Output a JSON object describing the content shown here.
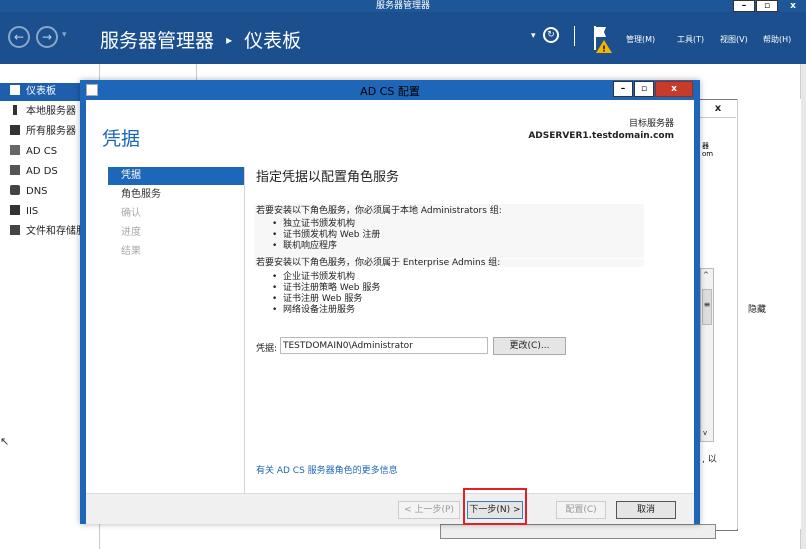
{
  "sm": {
    "title": "服务器管理器",
    "crumb": "服务器管理器",
    "crumb_page": "仪表板",
    "menus": [
      "管理(M)",
      "工具(T)",
      "视图(V)",
      "帮助(H)"
    ]
  },
  "nav": {
    "items": [
      "仪表板",
      "本地服务器",
      "所有服务器",
      "AD CS",
      "AD DS",
      "DNS",
      "IIS",
      "文件和存储服务"
    ]
  },
  "bg": {
    "target_frag1": "器",
    "target_frag2": "om",
    "hide_label": "隐藏",
    "text_frag": ", 以"
  },
  "dialog": {
    "title": "AD CS 配置",
    "heading": "凭据",
    "target_label": "目标服务器",
    "target_server": "ADSERVER1.testdomain.com",
    "steps": [
      "凭据",
      "角色服务",
      "确认",
      "进度",
      "结果"
    ],
    "section_title": "指定凭据以配置角色服务",
    "local_admin_text": "若要安装以下角色服务，你必须属于本地 Administrators 组:",
    "local_admin_items": [
      "独立证书颁发机构",
      "证书颁发机构 Web 注册",
      "联机响应程序"
    ],
    "enterprise_text": "若要安装以下角色服务，你必须属于 Enterprise Admins 组:",
    "enterprise_items": [
      "企业证书颁发机构",
      "证书注册策略 Web 服务",
      "证书注册 Web 服务",
      "网络设备注册服务"
    ],
    "credential_label": "凭据:",
    "credential_value": "TESTDOMAIN0\\Administrator",
    "change_button": "更改(C)...",
    "more_info_link": "有关 AD CS 服务器角色的更多信息",
    "prev_button": "< 上一步(P)",
    "next_button": "下一步(N) >",
    "configure_button": "配置(C)",
    "cancel_button": "取消"
  }
}
